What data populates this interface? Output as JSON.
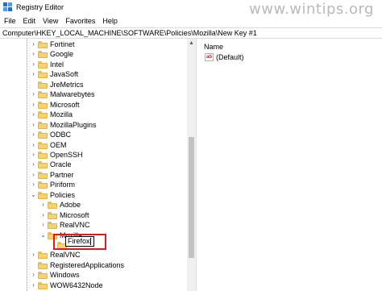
{
  "window": {
    "title": "Registry Editor"
  },
  "watermark": "www.wintips.org",
  "menu": [
    "File",
    "Edit",
    "View",
    "Favorites",
    "Help"
  ],
  "address": "Computer\\HKEY_LOCAL_MACHINE\\SOFTWARE\\Policies\\Mozilla\\New Key #1",
  "tree": {
    "items": [
      {
        "label": "Fortinet",
        "depth": 0,
        "state": "collapsed"
      },
      {
        "label": "Google",
        "depth": 0,
        "state": "collapsed"
      },
      {
        "label": "Intel",
        "depth": 0,
        "state": "collapsed"
      },
      {
        "label": "JavaSoft",
        "depth": 0,
        "state": "collapsed"
      },
      {
        "label": "JreMetrics",
        "depth": 0,
        "state": "none"
      },
      {
        "label": "Malwarebytes",
        "depth": 0,
        "state": "collapsed"
      },
      {
        "label": "Microsoft",
        "depth": 0,
        "state": "collapsed"
      },
      {
        "label": "Mozilla",
        "depth": 0,
        "state": "collapsed"
      },
      {
        "label": "MozillaPlugins",
        "depth": 0,
        "state": "collapsed"
      },
      {
        "label": "ODBC",
        "depth": 0,
        "state": "collapsed"
      },
      {
        "label": "OEM",
        "depth": 0,
        "state": "collapsed"
      },
      {
        "label": "OpenSSH",
        "depth": 0,
        "state": "collapsed"
      },
      {
        "label": "Oracle",
        "depth": 0,
        "state": "collapsed"
      },
      {
        "label": "Partner",
        "depth": 0,
        "state": "collapsed"
      },
      {
        "label": "Piriform",
        "depth": 0,
        "state": "collapsed"
      },
      {
        "label": "Policies",
        "depth": 0,
        "state": "expanded"
      },
      {
        "label": "Adobe",
        "depth": 1,
        "state": "collapsed"
      },
      {
        "label": "Microsoft",
        "depth": 1,
        "state": "collapsed"
      },
      {
        "label": "RealVNC",
        "depth": 1,
        "state": "collapsed"
      },
      {
        "label": "Mozilla",
        "depth": 1,
        "state": "expanded"
      },
      {
        "label": "",
        "depth": 2,
        "state": "none"
      },
      {
        "label": "RealVNC",
        "depth": 0,
        "state": "collapsed"
      },
      {
        "label": "RegisteredApplications",
        "depth": 0,
        "state": "none"
      },
      {
        "label": "Windows",
        "depth": 0,
        "state": "collapsed"
      },
      {
        "label": "WOW6432Node",
        "depth": 0,
        "state": "collapsed"
      }
    ]
  },
  "rename": {
    "value": "Firefox"
  },
  "right_pane": {
    "column_header": "Name",
    "values": [
      {
        "icon": "string-value-icon",
        "name": "(Default)"
      }
    ]
  },
  "colors": {
    "highlight": "#e01a1a",
    "folder": "#f5d275"
  }
}
